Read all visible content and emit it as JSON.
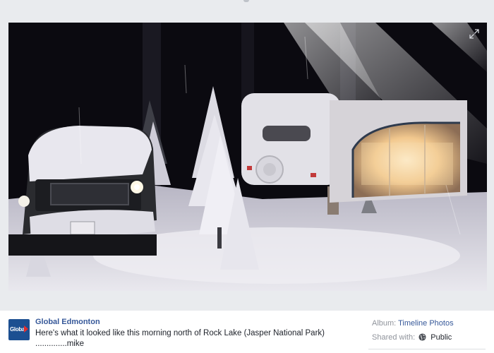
{
  "photo": {
    "alt_subject": "snow-covered-truck-and-camper",
    "colors": {
      "snow": "#e6e4ea",
      "night_sky": "#0b0a10",
      "tent_glow": "#f5c98a",
      "truck": "#2a2b2f"
    }
  },
  "post": {
    "author": "Global Edmonton",
    "avatar_label": "Global",
    "text_line1": "Here's what it looked like this morning north of Rock Lake (Jasper National Park)",
    "text_line2": "..............mike"
  },
  "sidebar_meta": {
    "album_label": "Album:",
    "album_value": "Timeline Photos",
    "shared_label": "Shared with:",
    "shared_value": "Public",
    "shared_icon": "globe-icon"
  },
  "icons": {
    "expand": "expand-icon",
    "globe": "globe-icon"
  }
}
